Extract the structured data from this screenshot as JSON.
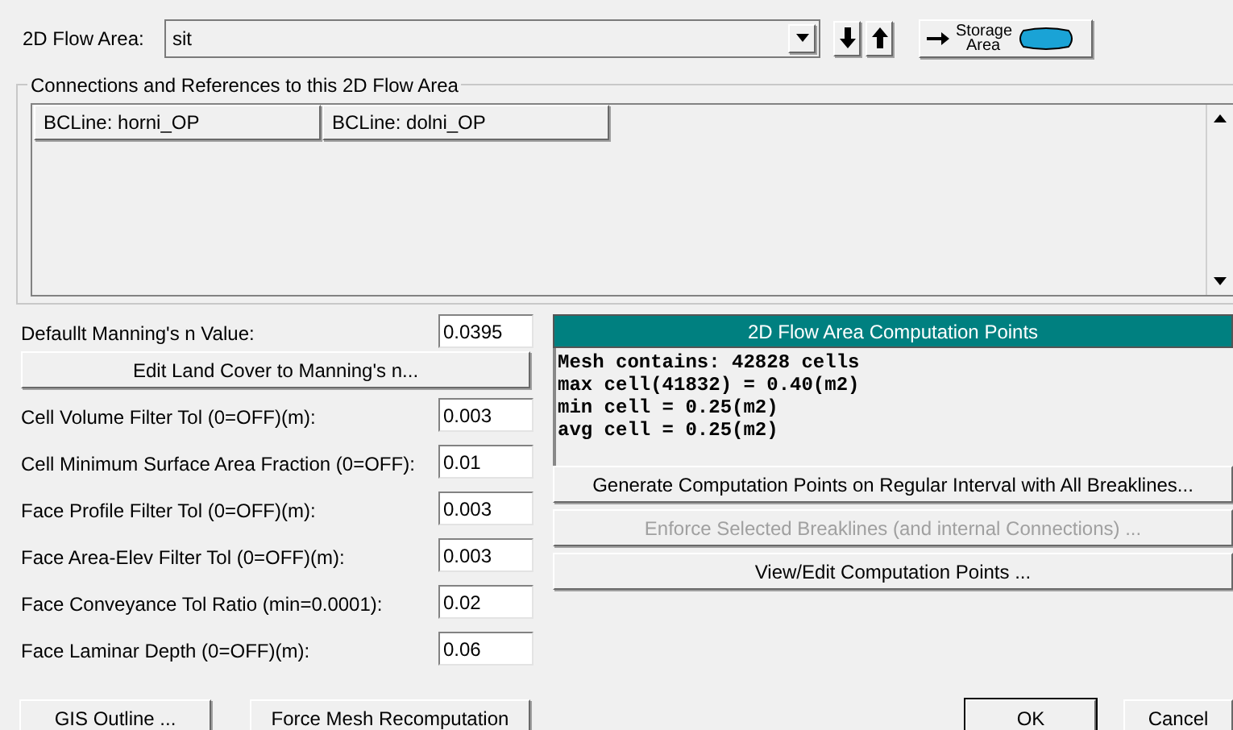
{
  "flow_area": {
    "label": "2D Flow Area:",
    "value": "sit",
    "storage_button": "Storage Area"
  },
  "connections": {
    "title": "Connections and References to this 2D Flow Area",
    "items": [
      "BCLine: horni_OP",
      "BCLine: dolni_OP"
    ]
  },
  "manning": {
    "label": "Defaullt Manning's n Value:",
    "value": "0.0395",
    "button": "Edit Land Cover to Manning's n..."
  },
  "fields": [
    {
      "label": "Cell Volume Filter Tol (0=OFF)(m):",
      "value": "0.003"
    },
    {
      "label": "Cell Minimum Surface Area Fraction (0=OFF):",
      "value": "0.01"
    },
    {
      "label": "Face Profile Filter Tol (0=OFF)(m):",
      "value": "0.003"
    },
    {
      "label": "Face Area-Elev Filter Tol (0=OFF)(m):",
      "value": "0.003"
    },
    {
      "label": "Face Conveyance Tol Ratio (min=0.0001):",
      "value": "0.02"
    },
    {
      "label": "Face Laminar Depth (0=OFF)(m):",
      "value": "0.06"
    }
  ],
  "computation": {
    "title": "2D Flow Area Computation Points",
    "lines": [
      "Mesh contains: 42828 cells",
      "max cell(41832) = 0.40(m2)",
      "min cell = 0.25(m2)",
      "avg cell = 0.25(m2)"
    ],
    "buttons": [
      {
        "label": "Generate Computation Points on Regular Interval with All Breaklines...",
        "disabled": false
      },
      {
        "label": "Enforce Selected Breaklines (and internal Connections) ...",
        "disabled": true
      },
      {
        "label": "View/Edit Computation Points ...",
        "disabled": false
      }
    ]
  },
  "bottom_buttons": [
    {
      "label": "GIS Outline ...",
      "default": false
    },
    {
      "label": "Force Mesh Recomputation",
      "default": false
    },
    {
      "label": "OK",
      "default": true
    },
    {
      "label": "Cancel",
      "default": false
    }
  ]
}
